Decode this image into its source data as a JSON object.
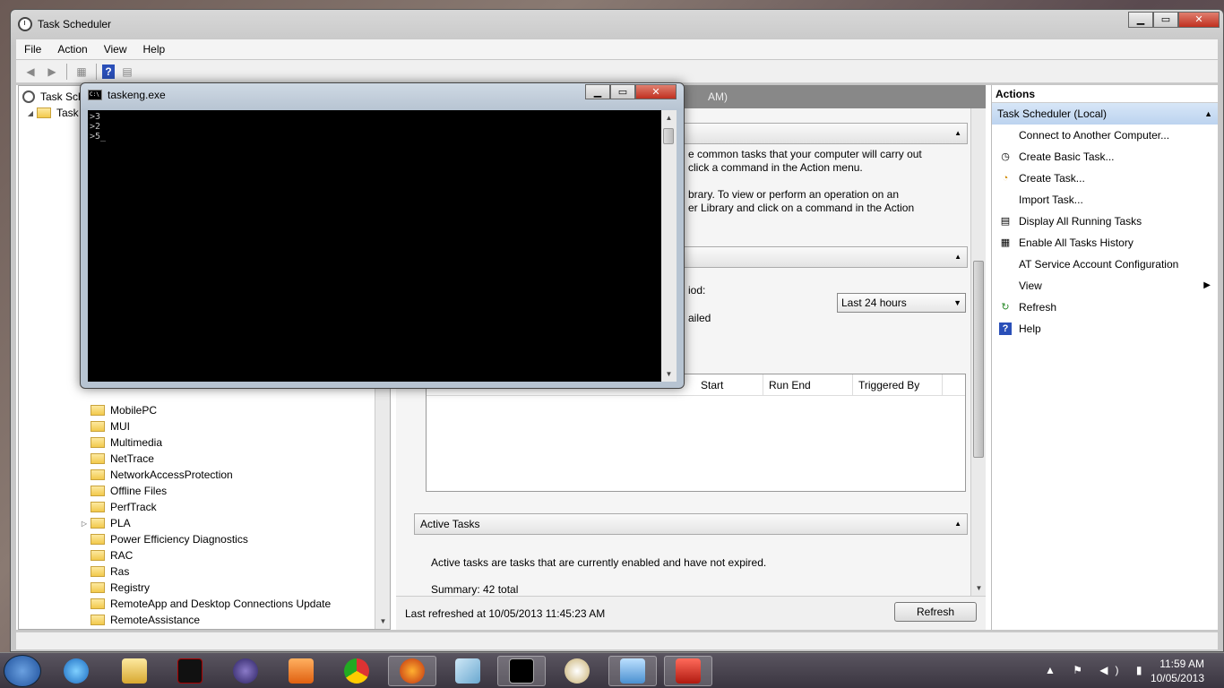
{
  "window": {
    "title": "Task Scheduler",
    "menu": [
      "File",
      "Action",
      "View",
      "Help"
    ]
  },
  "tree": {
    "root_label": "Task Scheduler (Local)",
    "library_label": "Task Scheduler Library",
    "items": [
      "MobilePC",
      "MUI",
      "Multimedia",
      "NetTrace",
      "NetworkAccessProtection",
      "Offline Files",
      "PerfTrack",
      "PLA",
      "Power Efficiency Diagnostics",
      "RAC",
      "Ras",
      "Registry",
      "RemoteApp and Desktop Connections Update",
      "RemoteAssistance"
    ]
  },
  "center": {
    "header_suffix": "AM)",
    "overview_text": [
      "e common tasks that your computer will carry out",
      "click a command in the Action menu.",
      "brary. To view or perform an operation on an",
      "er Library and click on a command in the Action"
    ],
    "period_label_fragment": "iod:",
    "period_select": "Last 24 hours",
    "failed_fragment": "ailed",
    "grid_columns": [
      "Start",
      "Run End",
      "Triggered By"
    ],
    "active_tasks": {
      "title": "Active Tasks",
      "description": "Active tasks are tasks that are currently enabled and have not expired.",
      "summary": "Summary: 42 total"
    },
    "last_refreshed": "Last refreshed at 10/05/2013 11:45:23 AM",
    "refresh_button": "Refresh"
  },
  "actions": {
    "title": "Actions",
    "group": "Task Scheduler (Local)",
    "items": [
      {
        "label": "Connect to Another Computer...",
        "icon": "none"
      },
      {
        "label": "Create Basic Task...",
        "icon": "clock-wizard-icon"
      },
      {
        "label": "Create Task...",
        "icon": "create-task-icon"
      },
      {
        "label": "Import Task...",
        "icon": "none"
      },
      {
        "label": "Display All Running Tasks",
        "icon": "running-tasks-icon"
      },
      {
        "label": "Enable All Tasks History",
        "icon": "history-icon"
      },
      {
        "label": "AT Service Account Configuration",
        "icon": "none"
      },
      {
        "label": "View",
        "icon": "none"
      },
      {
        "label": "Refresh",
        "icon": "refresh-icon"
      },
      {
        "label": "Help",
        "icon": "help-icon"
      }
    ]
  },
  "console": {
    "title": "taskeng.exe",
    "lines": [
      ">3",
      ">2",
      ">5_"
    ]
  },
  "taskbar": {
    "time": "11:59 AM",
    "date": "10/05/2013"
  },
  "colors": {
    "accent": "#bcd3ef",
    "close": "#c03020"
  }
}
